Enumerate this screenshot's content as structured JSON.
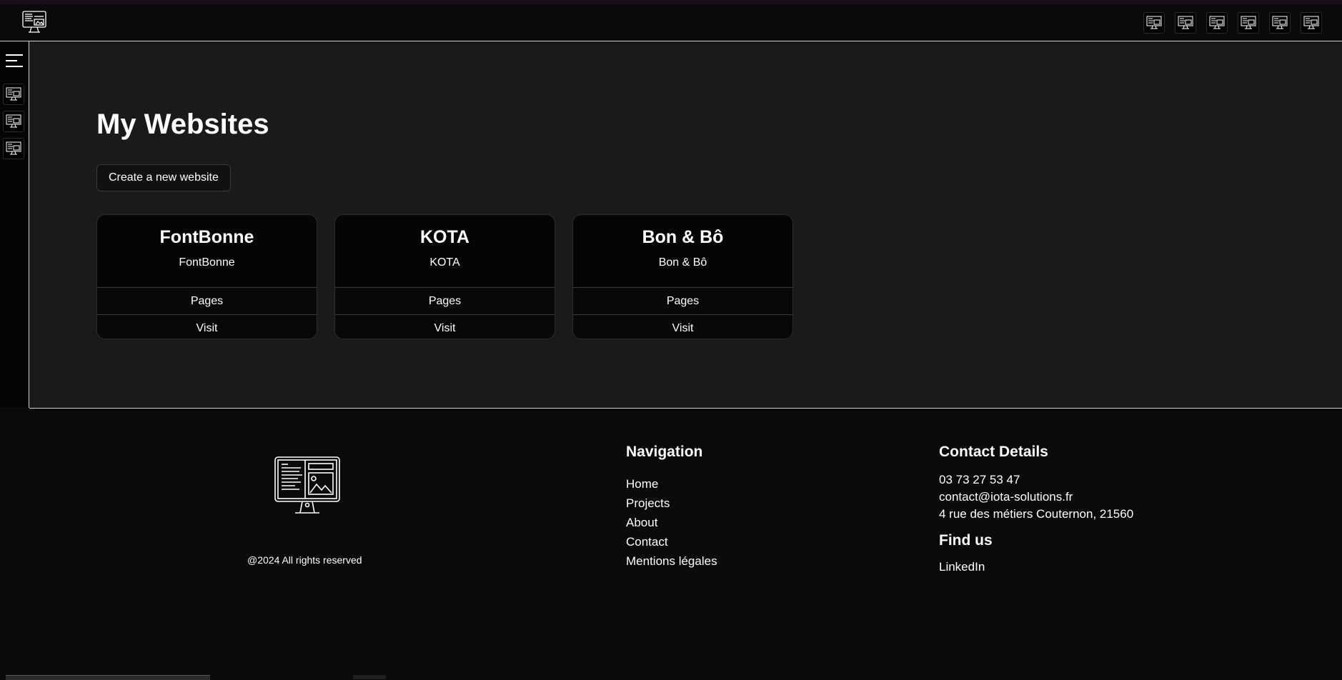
{
  "main": {
    "title": "My Websites",
    "create_label": "Create a new website"
  },
  "websites": [
    {
      "name": "FontBonne",
      "subtitle": "FontBonne",
      "pages_label": "Pages",
      "visit_label": "Visit"
    },
    {
      "name": "KOTA",
      "subtitle": "KOTA",
      "pages_label": "Pages",
      "visit_label": "Visit"
    },
    {
      "name": "Bon & Bô",
      "subtitle": "Bon & Bô",
      "pages_label": "Pages",
      "visit_label": "Visit"
    }
  ],
  "footer": {
    "copyright": "@2024 All rights reserved",
    "nav_heading": "Navigation",
    "nav_links": [
      "Home",
      "Projects",
      "About",
      "Contact",
      "Mentions légales"
    ],
    "contact_heading": "Contact Details",
    "phone": "03 73 27 53 47",
    "email": "contact@iota-solutions.fr",
    "address": "4 rue des métiers Couternon, 21560",
    "findus_heading": "Find us",
    "linkedin": "LinkedIn"
  },
  "colors": {
    "background_main": "#1a1a1b",
    "background_bar": "#0a0a0a",
    "card_background": "#050505",
    "text": "#ffffff",
    "border_light": "#cfcfcf"
  },
  "icons": {
    "logo": "computer-monitor-icon",
    "menu": "hamburger-menu-icon",
    "nav_items": "computer-monitor-icon"
  }
}
